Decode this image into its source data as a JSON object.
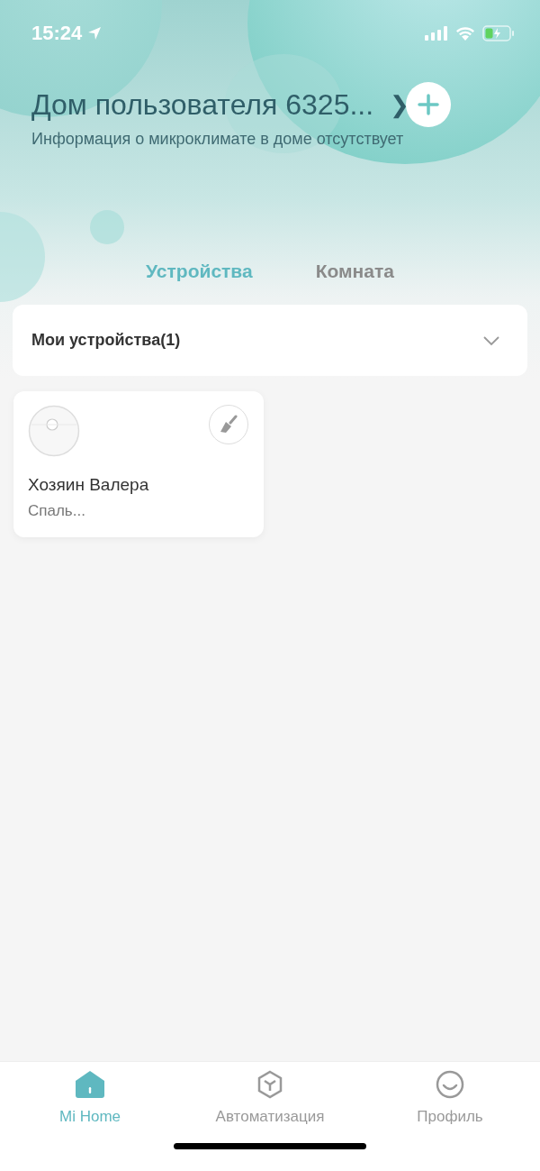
{
  "status_bar": {
    "time": "15:24"
  },
  "header": {
    "title": "Дом пользователя 6325...",
    "chevron": "❯",
    "subtitle": "Информация о микроклимате в доме отсутствует"
  },
  "tabs": [
    {
      "label": "Устройства",
      "selected": true
    },
    {
      "label": "Комната",
      "selected": false
    }
  ],
  "section": {
    "title": "Мои устройства(1)"
  },
  "devices": [
    {
      "name": "Хозяин Валера",
      "room": "Спаль..."
    }
  ],
  "nav": [
    {
      "kind": "home",
      "label": "Mi Home",
      "selected": true
    },
    {
      "kind": "automation",
      "label": "Автоматизация",
      "selected": false
    },
    {
      "kind": "profile",
      "label": "Профиль",
      "selected": false
    }
  ]
}
